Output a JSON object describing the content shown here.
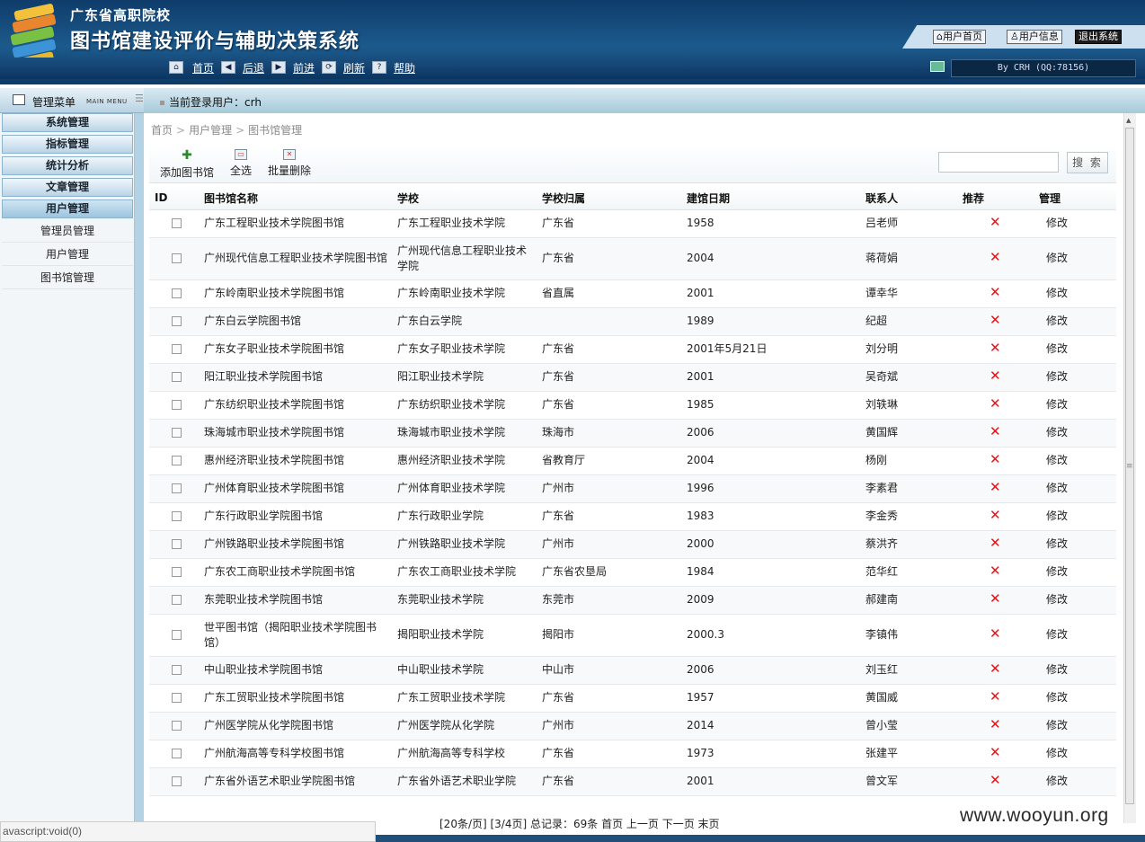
{
  "header": {
    "subtitle": "广东省高职院校",
    "title": "图书馆建设评价与辅助决策系统",
    "btn_home": "用户首页",
    "btn_info": "用户信息",
    "btn_logout": "退出系统"
  },
  "nav": {
    "home": "首页",
    "back": "后退",
    "forward": "前进",
    "refresh": "刷新",
    "help": "帮助",
    "byline": "By CRH (QQ:78156)"
  },
  "menu": {
    "title": "管理菜单",
    "title_en": "MAIN MENU"
  },
  "current_user": "当前登录用户：crh",
  "sidebar": {
    "sections": [
      "系统管理",
      "指标管理",
      "统计分析",
      "文章管理",
      "用户管理"
    ],
    "items": [
      "管理员管理",
      "用户管理",
      "图书馆管理"
    ]
  },
  "breadcrumb": [
    "首页",
    "用户管理",
    "图书馆管理"
  ],
  "toolbar": {
    "add": "添加图书馆",
    "select_all": "全选",
    "batch_delete": "批量删除",
    "search_value": "",
    "search_btn": "搜 索"
  },
  "columns": [
    "ID",
    "图书馆名称",
    "学校",
    "学校归属",
    "建馆日期",
    "联系人",
    "推荐",
    "管理"
  ],
  "rows": [
    [
      "广东工程职业技术学院图书馆",
      "广东工程职业技术学院",
      "广东省",
      "1958",
      "吕老师",
      "修改"
    ],
    [
      "广州现代信息工程职业技术学院图书馆",
      "广州现代信息工程职业技术学院",
      "广东省",
      "2004",
      "蒋荷娟",
      "修改"
    ],
    [
      "广东岭南职业技术学院图书馆",
      "广东岭南职业技术学院",
      "省直属",
      "2001",
      "谭幸华",
      "修改"
    ],
    [
      "广东白云学院图书馆",
      "广东白云学院",
      "",
      "1989",
      "纪超",
      "修改"
    ],
    [
      "广东女子职业技术学院图书馆",
      "广东女子职业技术学院",
      "广东省",
      "2001年5月21日",
      "刘分明",
      "修改"
    ],
    [
      "阳江职业技术学院图书馆",
      "阳江职业技术学院",
      "广东省",
      "2001",
      "吴奇斌",
      "修改"
    ],
    [
      "广东纺织职业技术学院图书馆",
      "广东纺织职业技术学院",
      "广东省",
      "1985",
      "刘轶琳",
      "修改"
    ],
    [
      "珠海城市职业技术学院图书馆",
      "珠海城市职业技术学院",
      "珠海市",
      "2006",
      "黄国辉",
      "修改"
    ],
    [
      "惠州经济职业技术学院图书馆",
      "惠州经济职业技术学院",
      "省教育厅",
      "2004",
      "杨刚",
      "修改"
    ],
    [
      "广州体育职业技术学院图书馆",
      "广州体育职业技术学院",
      "广州市",
      "1996",
      "李素君",
      "修改"
    ],
    [
      "广东行政职业学院图书馆",
      "广东行政职业学院",
      "广东省",
      "1983",
      "李金秀",
      "修改"
    ],
    [
      "广州铁路职业技术学院图书馆",
      "广州铁路职业技术学院",
      "广州市",
      "2000",
      "蔡洪齐",
      "修改"
    ],
    [
      "广东农工商职业技术学院图书馆",
      "广东农工商职业技术学院",
      "广东省农垦局",
      "1984",
      "范华红",
      "修改"
    ],
    [
      "东莞职业技术学院图书馆",
      "东莞职业技术学院",
      "东莞市",
      "2009",
      "郝建南",
      "修改"
    ],
    [
      "世平图书馆（揭阳职业技术学院图书馆）",
      "揭阳职业技术学院",
      "揭阳市",
      "2000.3",
      "李镇伟",
      "修改"
    ],
    [
      "中山职业技术学院图书馆",
      "中山职业技术学院",
      "中山市",
      "2006",
      "刘玉红",
      "修改"
    ],
    [
      "广东工贸职业技术学院图书馆",
      "广东工贸职业技术学院",
      "广东省",
      "1957",
      "黄国威",
      "修改"
    ],
    [
      "广州医学院从化学院图书馆",
      "广州医学院从化学院",
      "广州市",
      "2014",
      "曾小莹",
      "修改"
    ],
    [
      "广州航海高等专科学校图书馆",
      "广州航海高等专科学校",
      "广东省",
      "1973",
      "张建平",
      "修改"
    ],
    [
      "广东省外语艺术职业学院图书馆",
      "广东省外语艺术职业学院",
      "广东省",
      "2001",
      "曾文军",
      "修改"
    ]
  ],
  "pager": "[20条/页] [3/4页] 总记录：69条  首页 上一页 下一页 末页",
  "status_text": "avascript:void(0)",
  "watermark": "www.wooyun.org",
  "colors": {
    "header": "#1c5a8c",
    "delete": "#e0141a"
  }
}
